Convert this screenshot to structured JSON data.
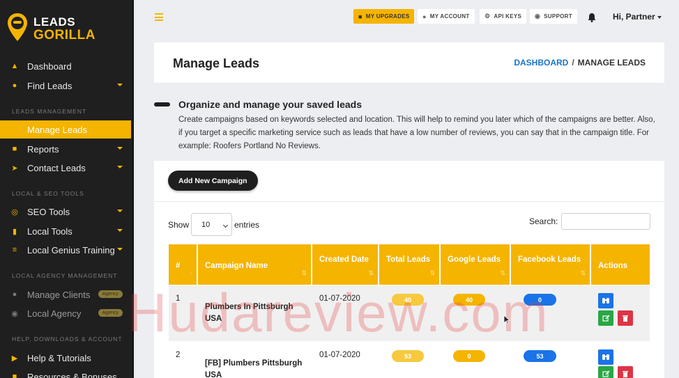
{
  "brand": {
    "line1": "LEADS",
    "line2": "GORILLA"
  },
  "sidebar": {
    "items": [
      {
        "label": "Dashboard",
        "icon": "fire-icon"
      },
      {
        "label": "Find Leads",
        "icon": "map-pin-icon"
      },
      {
        "label": "Manage Leads",
        "icon": "none"
      },
      {
        "label": "Reports",
        "icon": "document-icon"
      },
      {
        "label": "Contact Leads",
        "icon": "paper-plane-icon"
      },
      {
        "label": "SEO Tools",
        "icon": "target-icon"
      },
      {
        "label": "Local Tools",
        "icon": "briefcase-icon"
      },
      {
        "label": "Local Genius Training",
        "icon": "list-icon"
      },
      {
        "label": "Manage Clients",
        "icon": "users-icon",
        "badge": "Agency"
      },
      {
        "label": "Local Agency",
        "icon": "globe-icon",
        "badge": "Agency"
      },
      {
        "label": "Help & Tutorials",
        "icon": "video-icon"
      },
      {
        "label": "Resources & Bonuses",
        "icon": "gift-icon"
      }
    ],
    "sections": {
      "leads": "LEADS MANAGEMENT",
      "seo": "LOCAL & SEO TOOLS",
      "agency": "LOCAL AGENCY MANAGEMENT",
      "help": "HELP, DOWNLOADS & ACCOUNT"
    }
  },
  "topbar": {
    "upgrades": "MY UPGRADES",
    "account": "MY ACCOUNT",
    "api": "API KEYS",
    "support": "SUPPORT",
    "user": "Hi, Partner"
  },
  "header": {
    "title": "Manage Leads",
    "crumb_link": "DASHBOARD",
    "crumb_sep": "/",
    "crumb_current": "MANAGE LEADS"
  },
  "info": {
    "title": "Organize and manage your saved leads",
    "text": "Create campaigns based on keywords selected and location. This will help to remind you later which of the campaigns are better. Also, if you target a specific marketing service such as leads that have a low number of reviews, you can say that in the campaign title. For example: Roofers Portland No Reviews."
  },
  "table_controls": {
    "add_button": "Add New Campaign",
    "show": "Show",
    "entries_value": "10",
    "entries": "entries",
    "search": "Search:"
  },
  "table": {
    "headers": {
      "num": "#",
      "name": "Campaign Name",
      "created": "Created Date",
      "total": "Total Leads",
      "google": "Google Leads",
      "facebook": "Facebook Leads",
      "actions": "Actions"
    },
    "rows": [
      {
        "num": "1",
        "name": "Plumbers In Pittsburgh USA",
        "created": "01-07-2020",
        "total": "40",
        "google": "40",
        "facebook": "0"
      },
      {
        "num": "2",
        "name": "[FB] Plumbers Pittsburgh USA",
        "created": "01-07-2020",
        "total": "53",
        "google": "0",
        "facebook": "53"
      }
    ]
  },
  "watermark": "Hudareview.com",
  "colors": {
    "accent": "#f5b400",
    "sidebar": "#1f1f1f",
    "blue": "#1a73e8",
    "green": "#28a745",
    "red": "#dc3545"
  }
}
